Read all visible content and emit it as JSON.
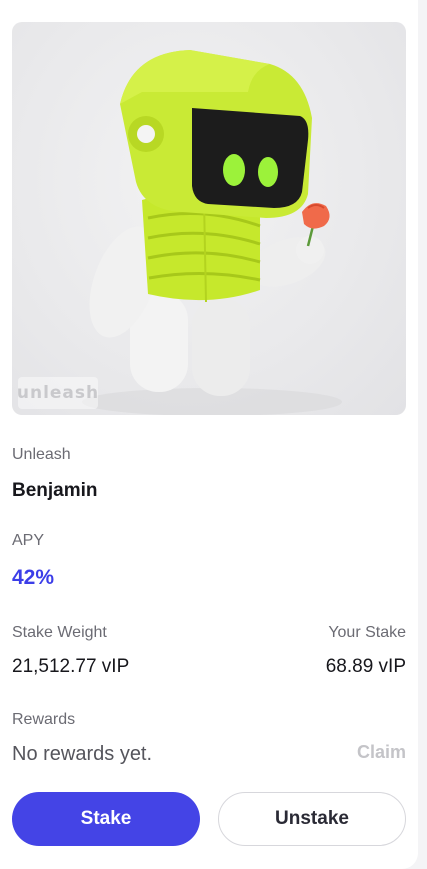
{
  "card": {
    "image_watermark": "unleash",
    "collection": "Unleash",
    "name": "Benjamin",
    "apy_label": "APY",
    "apy_value": "42%",
    "stake_weight_label": "Stake Weight",
    "stake_weight_value": "21,512.77 vIP",
    "your_stake_label": "Your Stake",
    "your_stake_value": "68.89 vIP",
    "rewards_label": "Rewards",
    "rewards_value": "No rewards yet.",
    "claim_label": "Claim",
    "stake_button": "Stake",
    "unstake_button": "Unstake"
  },
  "colors": {
    "accent": "#4444e6",
    "apy": "#3c3ee8",
    "robot_lime": "#c6e82c",
    "claim_disabled": "#c4c4c8"
  }
}
